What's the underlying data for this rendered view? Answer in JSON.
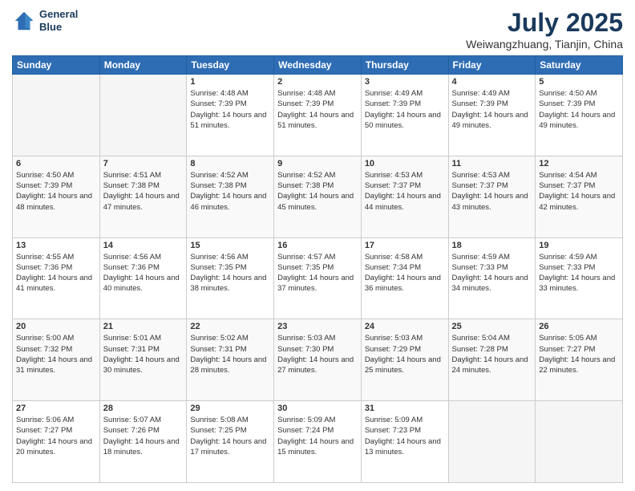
{
  "header": {
    "logo_line1": "General",
    "logo_line2": "Blue",
    "title": "July 2025",
    "subtitle": "Weiwangzhuang, Tianjin, China"
  },
  "calendar": {
    "days_of_week": [
      "Sunday",
      "Monday",
      "Tuesday",
      "Wednesday",
      "Thursday",
      "Friday",
      "Saturday"
    ],
    "weeks": [
      [
        {
          "day": "",
          "sunrise": "",
          "sunset": "",
          "daylight": ""
        },
        {
          "day": "",
          "sunrise": "",
          "sunset": "",
          "daylight": ""
        },
        {
          "day": "1",
          "sunrise": "Sunrise: 4:48 AM",
          "sunset": "Sunset: 7:39 PM",
          "daylight": "Daylight: 14 hours and 51 minutes."
        },
        {
          "day": "2",
          "sunrise": "Sunrise: 4:48 AM",
          "sunset": "Sunset: 7:39 PM",
          "daylight": "Daylight: 14 hours and 51 minutes."
        },
        {
          "day": "3",
          "sunrise": "Sunrise: 4:49 AM",
          "sunset": "Sunset: 7:39 PM",
          "daylight": "Daylight: 14 hours and 50 minutes."
        },
        {
          "day": "4",
          "sunrise": "Sunrise: 4:49 AM",
          "sunset": "Sunset: 7:39 PM",
          "daylight": "Daylight: 14 hours and 49 minutes."
        },
        {
          "day": "5",
          "sunrise": "Sunrise: 4:50 AM",
          "sunset": "Sunset: 7:39 PM",
          "daylight": "Daylight: 14 hours and 49 minutes."
        }
      ],
      [
        {
          "day": "6",
          "sunrise": "Sunrise: 4:50 AM",
          "sunset": "Sunset: 7:39 PM",
          "daylight": "Daylight: 14 hours and 48 minutes."
        },
        {
          "day": "7",
          "sunrise": "Sunrise: 4:51 AM",
          "sunset": "Sunset: 7:38 PM",
          "daylight": "Daylight: 14 hours and 47 minutes."
        },
        {
          "day": "8",
          "sunrise": "Sunrise: 4:52 AM",
          "sunset": "Sunset: 7:38 PM",
          "daylight": "Daylight: 14 hours and 46 minutes."
        },
        {
          "day": "9",
          "sunrise": "Sunrise: 4:52 AM",
          "sunset": "Sunset: 7:38 PM",
          "daylight": "Daylight: 14 hours and 45 minutes."
        },
        {
          "day": "10",
          "sunrise": "Sunrise: 4:53 AM",
          "sunset": "Sunset: 7:37 PM",
          "daylight": "Daylight: 14 hours and 44 minutes."
        },
        {
          "day": "11",
          "sunrise": "Sunrise: 4:53 AM",
          "sunset": "Sunset: 7:37 PM",
          "daylight": "Daylight: 14 hours and 43 minutes."
        },
        {
          "day": "12",
          "sunrise": "Sunrise: 4:54 AM",
          "sunset": "Sunset: 7:37 PM",
          "daylight": "Daylight: 14 hours and 42 minutes."
        }
      ],
      [
        {
          "day": "13",
          "sunrise": "Sunrise: 4:55 AM",
          "sunset": "Sunset: 7:36 PM",
          "daylight": "Daylight: 14 hours and 41 minutes."
        },
        {
          "day": "14",
          "sunrise": "Sunrise: 4:56 AM",
          "sunset": "Sunset: 7:36 PM",
          "daylight": "Daylight: 14 hours and 40 minutes."
        },
        {
          "day": "15",
          "sunrise": "Sunrise: 4:56 AM",
          "sunset": "Sunset: 7:35 PM",
          "daylight": "Daylight: 14 hours and 38 minutes."
        },
        {
          "day": "16",
          "sunrise": "Sunrise: 4:57 AM",
          "sunset": "Sunset: 7:35 PM",
          "daylight": "Daylight: 14 hours and 37 minutes."
        },
        {
          "day": "17",
          "sunrise": "Sunrise: 4:58 AM",
          "sunset": "Sunset: 7:34 PM",
          "daylight": "Daylight: 14 hours and 36 minutes."
        },
        {
          "day": "18",
          "sunrise": "Sunrise: 4:59 AM",
          "sunset": "Sunset: 7:33 PM",
          "daylight": "Daylight: 14 hours and 34 minutes."
        },
        {
          "day": "19",
          "sunrise": "Sunrise: 4:59 AM",
          "sunset": "Sunset: 7:33 PM",
          "daylight": "Daylight: 14 hours and 33 minutes."
        }
      ],
      [
        {
          "day": "20",
          "sunrise": "Sunrise: 5:00 AM",
          "sunset": "Sunset: 7:32 PM",
          "daylight": "Daylight: 14 hours and 31 minutes."
        },
        {
          "day": "21",
          "sunrise": "Sunrise: 5:01 AM",
          "sunset": "Sunset: 7:31 PM",
          "daylight": "Daylight: 14 hours and 30 minutes."
        },
        {
          "day": "22",
          "sunrise": "Sunrise: 5:02 AM",
          "sunset": "Sunset: 7:31 PM",
          "daylight": "Daylight: 14 hours and 28 minutes."
        },
        {
          "day": "23",
          "sunrise": "Sunrise: 5:03 AM",
          "sunset": "Sunset: 7:30 PM",
          "daylight": "Daylight: 14 hours and 27 minutes."
        },
        {
          "day": "24",
          "sunrise": "Sunrise: 5:03 AM",
          "sunset": "Sunset: 7:29 PM",
          "daylight": "Daylight: 14 hours and 25 minutes."
        },
        {
          "day": "25",
          "sunrise": "Sunrise: 5:04 AM",
          "sunset": "Sunset: 7:28 PM",
          "daylight": "Daylight: 14 hours and 24 minutes."
        },
        {
          "day": "26",
          "sunrise": "Sunrise: 5:05 AM",
          "sunset": "Sunset: 7:27 PM",
          "daylight": "Daylight: 14 hours and 22 minutes."
        }
      ],
      [
        {
          "day": "27",
          "sunrise": "Sunrise: 5:06 AM",
          "sunset": "Sunset: 7:27 PM",
          "daylight": "Daylight: 14 hours and 20 minutes."
        },
        {
          "day": "28",
          "sunrise": "Sunrise: 5:07 AM",
          "sunset": "Sunset: 7:26 PM",
          "daylight": "Daylight: 14 hours and 18 minutes."
        },
        {
          "day": "29",
          "sunrise": "Sunrise: 5:08 AM",
          "sunset": "Sunset: 7:25 PM",
          "daylight": "Daylight: 14 hours and 17 minutes."
        },
        {
          "day": "30",
          "sunrise": "Sunrise: 5:09 AM",
          "sunset": "Sunset: 7:24 PM",
          "daylight": "Daylight: 14 hours and 15 minutes."
        },
        {
          "day": "31",
          "sunrise": "Sunrise: 5:09 AM",
          "sunset": "Sunset: 7:23 PM",
          "daylight": "Daylight: 14 hours and 13 minutes."
        },
        {
          "day": "",
          "sunrise": "",
          "sunset": "",
          "daylight": ""
        },
        {
          "day": "",
          "sunrise": "",
          "sunset": "",
          "daylight": ""
        }
      ]
    ]
  }
}
